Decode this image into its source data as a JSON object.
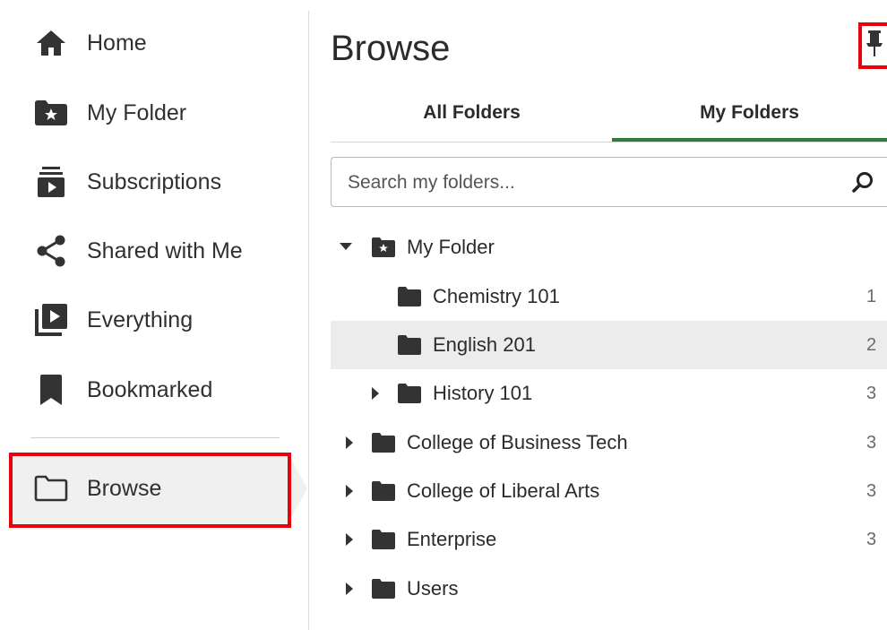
{
  "sidebar": {
    "items": [
      {
        "label": "Home",
        "icon": "home-icon"
      },
      {
        "label": "My Folder",
        "icon": "star-folder-icon"
      },
      {
        "label": "Subscriptions",
        "icon": "subscriptions-icon"
      },
      {
        "label": "Shared with Me",
        "icon": "share-icon"
      },
      {
        "label": "Everything",
        "icon": "media-library-icon"
      },
      {
        "label": "Bookmarked",
        "icon": "bookmark-icon"
      }
    ],
    "browse": {
      "label": "Browse",
      "icon": "folder-outline-icon",
      "selected": true
    }
  },
  "main": {
    "title": "Browse",
    "tabs": [
      {
        "label": "All Folders",
        "active": false
      },
      {
        "label": "My Folders",
        "active": true
      }
    ],
    "search": {
      "placeholder": "Search my folders...",
      "value": ""
    },
    "tree": [
      {
        "label": "My Folder",
        "level": 0,
        "expander": "expanded",
        "icon": "star-folder-icon",
        "count": ""
      },
      {
        "label": "Chemistry 101",
        "level": 1,
        "expander": "none",
        "icon": "folder-icon",
        "count": "1"
      },
      {
        "label": "English 201",
        "level": 1,
        "expander": "none",
        "icon": "folder-icon",
        "count": "2",
        "selected": true
      },
      {
        "label": "History 101",
        "level": 1,
        "expander": "collapsed",
        "icon": "folder-icon",
        "count": "3"
      },
      {
        "label": "College of Business Tech",
        "level": 0,
        "expander": "collapsed",
        "icon": "folder-icon",
        "count": "3"
      },
      {
        "label": "College of Liberal Arts",
        "level": 0,
        "expander": "collapsed",
        "icon": "folder-icon",
        "count": "3"
      },
      {
        "label": "Enterprise",
        "level": 0,
        "expander": "collapsed",
        "icon": "folder-icon",
        "count": "3"
      },
      {
        "label": "Users",
        "level": 0,
        "expander": "collapsed",
        "icon": "folder-icon",
        "count": ""
      }
    ]
  },
  "colors": {
    "accent_tab": "#2f7d3c",
    "highlight": "#e8000b",
    "icon": "#3a3a3a"
  }
}
